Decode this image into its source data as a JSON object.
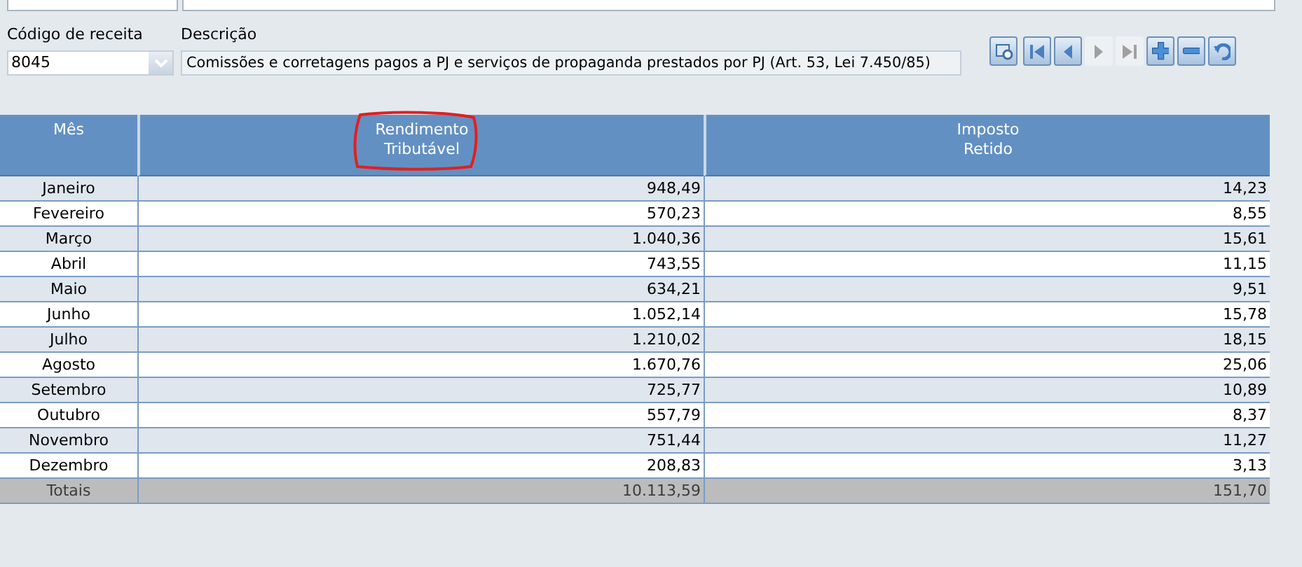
{
  "form": {
    "top_fields": [
      {
        "kind": "field"
      },
      {
        "kind": "field"
      }
    ],
    "code_label": "Código de receita",
    "code_value": "8045",
    "description_label": "Descrição",
    "description_value": "Comissões e corretagens pagos a PJ e serviços de propaganda prestados por PJ (Art. 53, Lei 7.450/85)"
  },
  "toolbar": [
    {
      "kind": "search",
      "disabled": false
    },
    {
      "kind": "first",
      "disabled": false
    },
    {
      "kind": "prev",
      "disabled": false
    },
    {
      "kind": "next",
      "disabled": true
    },
    {
      "kind": "last",
      "disabled": true
    },
    {
      "kind": "add",
      "disabled": false
    },
    {
      "kind": "remove",
      "disabled": false
    },
    {
      "kind": "refresh",
      "disabled": false
    }
  ],
  "table": {
    "columns": [
      {
        "label": "Mês",
        "circled": false
      },
      {
        "label": "Rendimento\nTributável",
        "circled": true
      },
      {
        "label": "Imposto\nRetido",
        "circled": false
      }
    ],
    "rows": [
      [
        "Janeiro",
        "948,49",
        "14,23"
      ],
      [
        "Fevereiro",
        "570,23",
        "8,55"
      ],
      [
        "Março",
        "1.040,36",
        "15,61"
      ],
      [
        "Abril",
        "743,55",
        "11,15"
      ],
      [
        "Maio",
        "634,21",
        "9,51"
      ],
      [
        "Junho",
        "1.052,14",
        "15,78"
      ],
      [
        "Julho",
        "1.210,02",
        "18,15"
      ],
      [
        "Agosto",
        "1.670,76",
        "25,06"
      ],
      [
        "Setembro",
        "725,77",
        "10,89"
      ],
      [
        "Outubro",
        "557,79",
        "8,37"
      ],
      [
        "Novembro",
        "751,44",
        "11,27"
      ],
      [
        "Dezembro",
        "208,83",
        "3,13"
      ]
    ],
    "totals": [
      "Totais",
      "10.113,59",
      "151,70"
    ]
  }
}
